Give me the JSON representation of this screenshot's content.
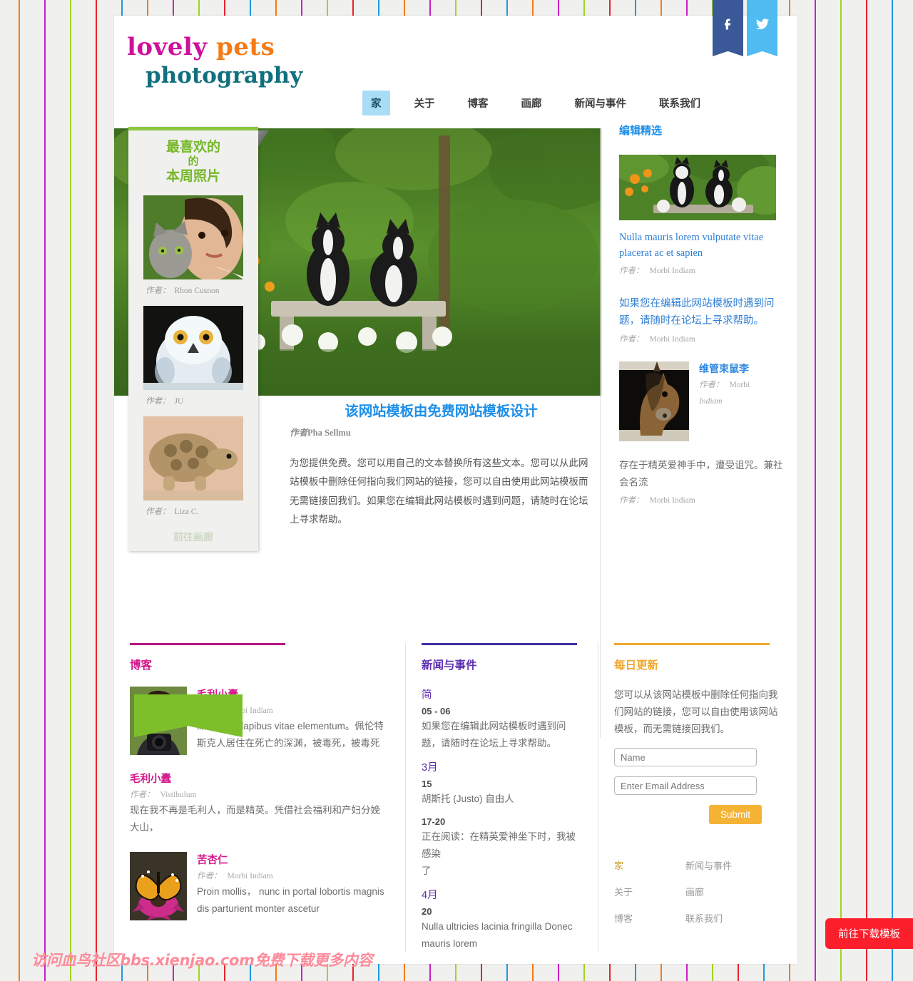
{
  "background": {
    "stripe_colors": [
      "#1a9ae0",
      "#f47b16",
      "#c81fc8",
      "#a4d224",
      "#e8232a"
    ],
    "page_bg": "#f0f0ee"
  },
  "header": {
    "logo": {
      "line1a": "lovely",
      "line1b": "pets",
      "line2": "photography",
      "color_lovely": "#cf0f9c",
      "color_pets": "#f47b16",
      "color_photography": "#11707c"
    },
    "social": [
      {
        "name": "facebook",
        "label": "f",
        "color": "#3b5998"
      },
      {
        "name": "twitter",
        "label": "",
        "color": "#4fbbf0"
      }
    ],
    "nav": [
      {
        "label": "家",
        "active": true
      },
      {
        "label": "关于",
        "active": false
      },
      {
        "label": "博客",
        "active": false
      },
      {
        "label": "画廊",
        "active": false
      },
      {
        "label": "新闻与事件",
        "active": false
      },
      {
        "label": "联系我们",
        "active": false
      }
    ]
  },
  "favorites": {
    "title_line1": "最喜欢的",
    "title_line2": "的",
    "title_line3": "本周照片",
    "by_label": "作者：",
    "items": [
      {
        "author": "Rhon Cusnon",
        "image": "girl-with-kitten"
      },
      {
        "author": "JU",
        "image": "snowy-owl"
      },
      {
        "author": "Liza C.",
        "image": "tortoise"
      }
    ],
    "gallery_link": "前往画廊"
  },
  "article": {
    "title": "该网站模板由免费网站模板设计",
    "by_label": "作者",
    "author": "Pha Sellmu",
    "body": "为您提供免费。您可以用自己的文本替换所有这些文本。您可以从此网站模板中删除任何指向我们网站的链接，您可以自由使用此网站模板而无需链接回我们。如果您在编辑此网站模板时遇到问题，请随时在论坛上寻求帮助。"
  },
  "rail": {
    "heading": "编辑精选",
    "by_label": "作者：",
    "item1": {
      "link": "Nulla mauris lorem vulputate vitae placerat ac et sapien",
      "author": "Morbi Indiam",
      "image": "two-boston-terriers"
    },
    "item2": {
      "link": "如果您在编辑此网站模板时遇到问题，请随时在论坛上寻求帮助。",
      "author": "Morbi Indiam"
    },
    "item3": {
      "title": "维管束鼠李",
      "author_line1": "Morbi",
      "author_line2": "Indiam",
      "image": "horse-head"
    },
    "item4": {
      "text": "存在于精英爱神手中，遭受诅咒。兼社会名流",
      "author": "Morbi Indiam"
    }
  },
  "blog": {
    "heading": "博客",
    "by_label": "作者：",
    "posts": [
      {
        "title": "毛利小蠹",
        "author": "Morbi Indiam",
        "text": "深褐色的 dapibus vitae elementum。佩伦特斯克人居住在死亡的深渊，被毒死，被毒死",
        "image": "photographer-portrait"
      },
      {
        "title": "毛利小蠹",
        "author": "Vistibulum",
        "text": "现在我不再是毛利人，而是精英。凭借社会福利和产妇分娩大山，",
        "image": null
      },
      {
        "title": "苦杏仁",
        "author": "Morbi Indiam",
        "text": "Proin mollis， nunc in portal lobortis magnis dis parturient monter ascetur",
        "image": "butterfly-on-flower"
      }
    ]
  },
  "news": {
    "heading": "新闻与事件",
    "entries": [
      {
        "month": "简",
        "day": "05 - 06",
        "text": "如果您在编辑此网站模板时遇到问题，请随时在论坛上寻求帮助。"
      },
      {
        "month": "3月",
        "day": "15",
        "text": "胡斯托 (Justo) 自由人"
      },
      {
        "month": "",
        "day": "17-20",
        "text": "正在阅读：在精英爱神坐下时，我被感染\n了"
      },
      {
        "month": "4月",
        "day": "20",
        "text": "Nulla ultricies lacinia fringilla Donec mauris lorem"
      }
    ]
  },
  "updates": {
    "heading": "每日更新",
    "intro": "您可以从该网站模板中删除任何指向我们网站的链接，您可以自由使用该网站模板，而无需链接回我们。",
    "name_placeholder": "Name",
    "email_placeholder": "Enter Email Address",
    "submit_label": "Submit",
    "footer_links_col1": [
      "家",
      "关于",
      "博客"
    ],
    "footer_links_col2": [
      "新闻与事件",
      "画廊",
      "联系我们"
    ]
  },
  "overlay": {
    "watermark": "访问血鸟社区bbs.xienjao.com免费下载更多内容",
    "download_button": "前往下载模板"
  }
}
